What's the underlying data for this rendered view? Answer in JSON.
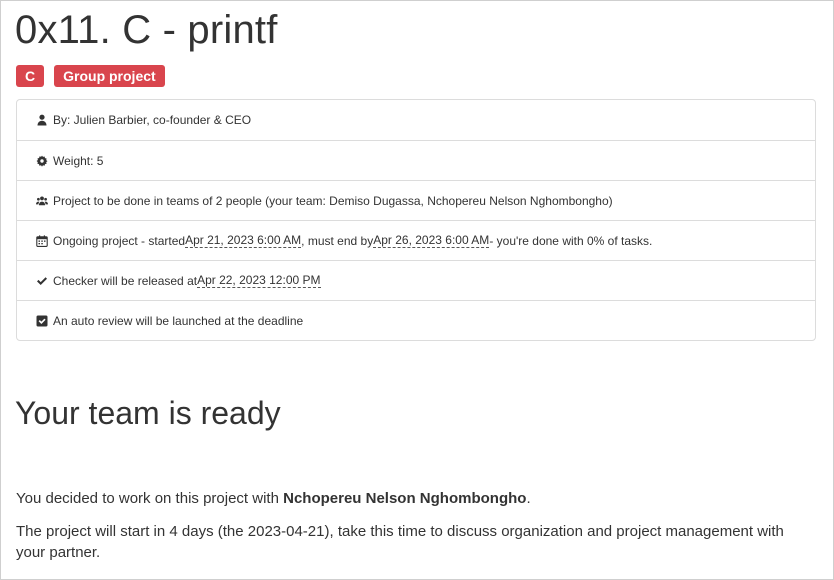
{
  "page": {
    "title": "0x11. C - printf",
    "badges": [
      "C",
      "Group project"
    ]
  },
  "info": {
    "author": "By: Julien Barbier, co-founder & CEO",
    "weight": "Weight: 5",
    "teams": "Project to be done in teams of 2 people (your team: Demiso Dugassa, Nchopereu Nelson Nghombongho)",
    "ongoing_prefix": "Ongoing project - started ",
    "start_date": "Apr 21, 2023 6:00 AM",
    "ongoing_middle": ", must end by",
    "end_date": "Apr 26, 2023 6:00 AM",
    "ongoing_suffix": "- you're done with 0% of tasks.",
    "checker_prefix": "Checker will be released at ",
    "checker_date": "Apr 22, 2023 12:00 PM",
    "auto_review": "An auto review will be launched at the deadline"
  },
  "team": {
    "heading": "Your team is ready",
    "p1_prefix": "You decided to work on this project with ",
    "partner": "Nchopereu Nelson Nghombongho",
    "p1_suffix": ".",
    "p2": "The project will start in 4 days (the 2023-04-21), take this time to discuss organization and project management with your partner."
  },
  "icons": [
    "user-icon",
    "gear-icon",
    "users-icon",
    "calendar-icon",
    "check-icon",
    "checkbox-checked-icon"
  ]
}
